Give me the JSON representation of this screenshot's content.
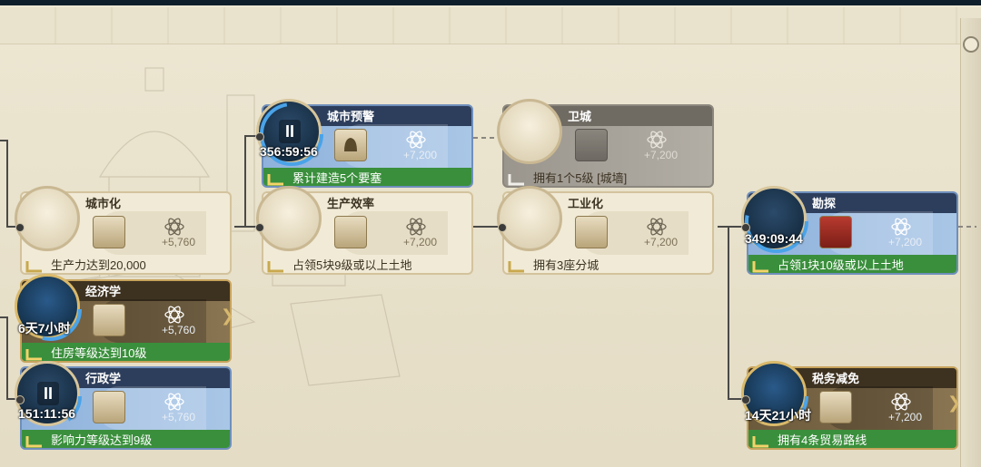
{
  "nodes": [
    {
      "key": "urban_warning",
      "title": "城市预警",
      "timer": "356:59:56",
      "requirement": "累计建造5个要塞",
      "reward": "+7,200",
      "theme": "blue",
      "medal_icon": "pause-icon",
      "boost_icon": "bell-icon"
    },
    {
      "key": "city_guard",
      "title": "卫城",
      "timer": "",
      "requirement": "拥有1个5级 [城墙]",
      "reward": "+7,200",
      "theme": "grey",
      "medal_icon": "tower-icon",
      "boost_icon": "wall-icon"
    },
    {
      "key": "urbanization",
      "title": "城市化",
      "timer": "",
      "requirement": "生产力达到20,000",
      "reward": "+5,760",
      "theme": "cream",
      "medal_icon": "house-icon",
      "boost_icon": "building-icon"
    },
    {
      "key": "production_efficiency",
      "title": "生产效率",
      "timer": "",
      "requirement": "占领5块9级或以上土地",
      "reward": "+7,200",
      "theme": "cream",
      "medal_icon": "sacks-icon",
      "boost_icon": "scroll-icon"
    },
    {
      "key": "industrialization",
      "title": "工业化",
      "timer": "",
      "requirement": "拥有3座分城",
      "reward": "+7,200",
      "theme": "cream",
      "medal_icon": "gears-icon",
      "boost_icon": "tower-icon"
    },
    {
      "key": "exploration",
      "title": "勘探",
      "timer": "349:09:44",
      "requirement": "占领1块10级或以上土地",
      "reward": "+7,200",
      "theme": "blue",
      "medal_icon": "drill-icon",
      "boost_icon": "ore-icon"
    },
    {
      "key": "economics",
      "title": "经济学",
      "timer": "6天7小时",
      "requirement": "住房等级达到10级",
      "reward": "+5,760",
      "theme": "gold",
      "medal_icon": "chart-icon",
      "boost_icon": "coin-icon"
    },
    {
      "key": "administration",
      "title": "行政学",
      "timer": "151:11:56",
      "requirement": "影响力等级达到9级",
      "reward": "+5,760",
      "theme": "blue",
      "medal_icon": "pause-icon",
      "boost_icon": "quill-icon"
    },
    {
      "key": "tax_relief",
      "title": "税务减免",
      "timer": "14天21小时",
      "requirement": "拥有4条贸易路线",
      "reward": "+7,200",
      "theme": "gold",
      "medal_icon": "chest-icon",
      "boost_icon": "scales-icon"
    }
  ],
  "colors": {
    "blue_card": "#8fb2dc",
    "green_footer": "#3a8f3c",
    "cream_card": "#f1ead6",
    "gold_card": "#6b5a3c",
    "grey_card": "#9a958d"
  }
}
